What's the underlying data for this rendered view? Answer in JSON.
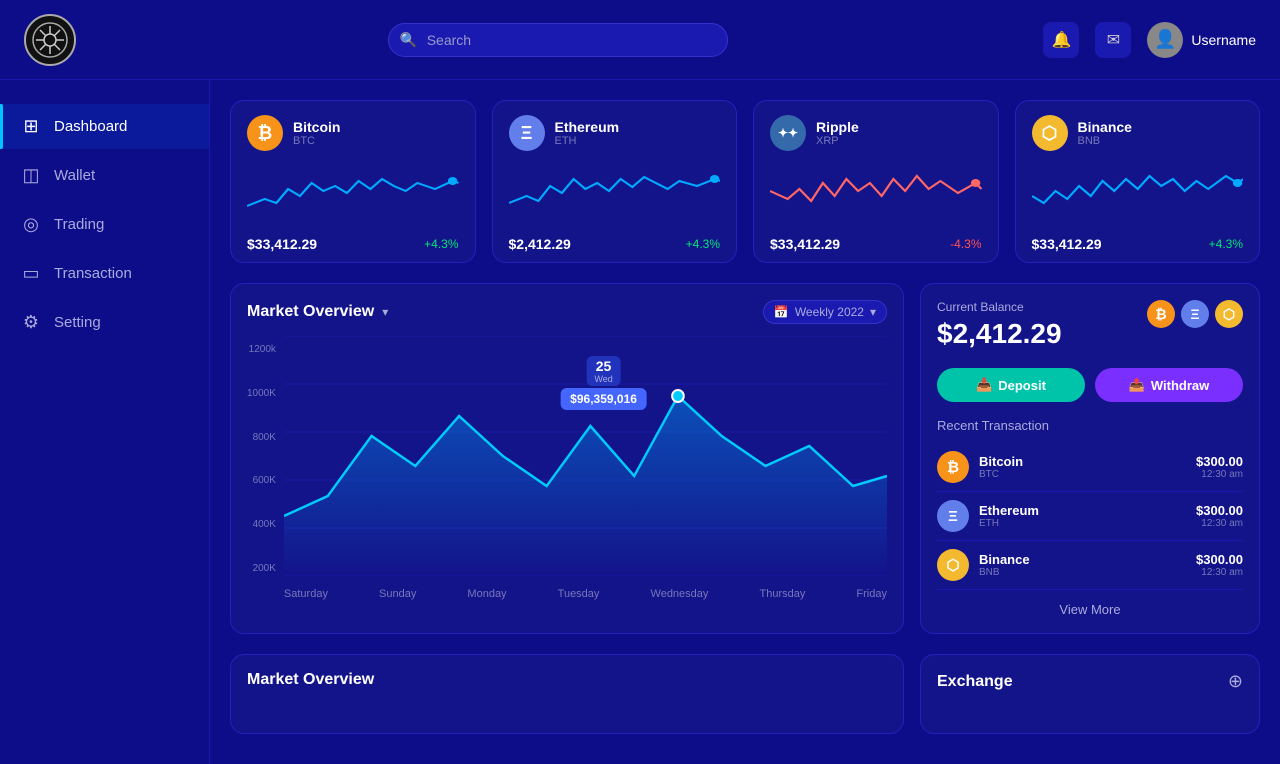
{
  "app": {
    "logo_alt": "Crypto App Logo"
  },
  "topnav": {
    "search_placeholder": "Search",
    "username": "Username"
  },
  "sidebar": {
    "items": [
      {
        "id": "dashboard",
        "label": "Dashboard",
        "icon": "⊞",
        "active": true
      },
      {
        "id": "wallet",
        "label": "Wallet",
        "icon": "◫",
        "active": false
      },
      {
        "id": "trading",
        "label": "Trading",
        "icon": "◎",
        "active": false
      },
      {
        "id": "transaction",
        "label": "Transaction",
        "icon": "▭",
        "active": false
      },
      {
        "id": "setting",
        "label": "Setting",
        "icon": "⚙",
        "active": false
      }
    ]
  },
  "crypto_cards": [
    {
      "id": "btc",
      "name": "Bitcoin",
      "symbol": "BTC",
      "price": "$33,412.29",
      "change": "+4.3%",
      "positive": true,
      "color": "#f7931a"
    },
    {
      "id": "eth",
      "name": "Ethereum",
      "symbol": "ETH",
      "price": "$2,412.29",
      "change": "+4.3%",
      "positive": true,
      "color": "#627eea"
    },
    {
      "id": "xrp",
      "name": "Ripple",
      "symbol": "XRP",
      "price": "$33,412.29",
      "change": "-4.3%",
      "positive": false,
      "color": "#346aa9"
    },
    {
      "id": "bnb",
      "name": "Binance",
      "symbol": "BNB",
      "price": "$33,412.29",
      "change": "+4.3%",
      "positive": true,
      "color": "#f3ba2f"
    }
  ],
  "market_overview": {
    "title": "Market Overview",
    "period_label": "Weekly 2022",
    "tooltip_day": "25",
    "tooltip_day_name": "Wed",
    "tooltip_value": "$96,359,016",
    "y_labels": [
      "1200k",
      "1000K",
      "800K",
      "600K",
      "400K",
      "200K"
    ],
    "x_labels": [
      "Saturday",
      "Sunday",
      "Monday",
      "Tuesday",
      "Wednesday",
      "Thursday",
      "Friday"
    ]
  },
  "balance_card": {
    "label": "Current Balance",
    "amount": "$2,412.29",
    "deposit_label": "Deposit",
    "withdraw_label": "Withdraw",
    "recent_label": "Recent Transaction",
    "transactions": [
      {
        "name": "Bitcoin",
        "symbol": "BTC",
        "amount": "$300.00",
        "time": "12:30 am",
        "color": "#f7931a",
        "icon_text": "₿"
      },
      {
        "name": "Ethereum",
        "symbol": "ETH",
        "amount": "$300.00",
        "time": "12:30 am",
        "color": "#627eea",
        "icon_text": "Ξ"
      },
      {
        "name": "Binance",
        "symbol": "BNB",
        "amount": "$300.00",
        "time": "12:30 am",
        "color": "#f3ba2f",
        "icon_text": "⬡"
      }
    ],
    "view_more": "View More"
  },
  "second_row": {
    "market_title": "Market Overview",
    "exchange_title": "Exchange",
    "exchange_icon": "⊕"
  }
}
